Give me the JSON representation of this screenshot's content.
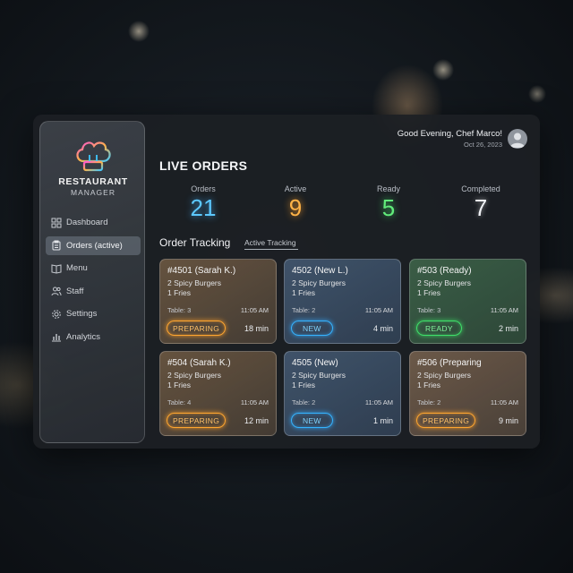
{
  "brand": {
    "name": "RESTAURANT",
    "sub": "MANAGER"
  },
  "sidebar": {
    "items": [
      {
        "label": "Dashboard",
        "icon": "grid-icon",
        "active": false
      },
      {
        "label": "Orders (active)",
        "icon": "clipboard-icon",
        "active": true
      },
      {
        "label": "Menu",
        "icon": "book-icon",
        "active": false
      },
      {
        "label": "Staff",
        "icon": "users-icon",
        "active": false
      },
      {
        "label": "Settings",
        "icon": "gear-icon",
        "active": false
      },
      {
        "label": "Analytics",
        "icon": "bar-chart-icon",
        "active": false
      }
    ]
  },
  "header": {
    "greeting": "Good Evening, Chef Marco!",
    "date": "Oct 26, 2023"
  },
  "page_title": "LIVE ORDERS",
  "stats": [
    {
      "label": "Orders",
      "value": "21",
      "color": "#5cc8ff"
    },
    {
      "label": "Active",
      "value": "9",
      "color": "#ffb347"
    },
    {
      "label": "Ready",
      "value": "5",
      "color": "#62ec7b"
    },
    {
      "label": "Completed",
      "value": "7",
      "color": "#f0f2f6"
    }
  ],
  "tracking": {
    "title": "Order Tracking",
    "tab": "Active Tracking"
  },
  "orders": [
    {
      "title": "#4501 (Sarah K.)",
      "items": [
        "2 Spicy Burgers",
        "1 Fries"
      ],
      "table": "Table: 3",
      "time": "11:05 AM",
      "status": "PREPARING",
      "elapsed": "18 min",
      "status_color": "#ffa630"
    },
    {
      "title": "4502 (New L.)",
      "items": [
        "2 Spicy Burgers",
        "1 Fries"
      ],
      "table": "Table: 2",
      "time": "11:05 AM",
      "status": "NEW",
      "elapsed": "4 min",
      "status_color": "#35b4ff"
    },
    {
      "title": "#503 (Ready)",
      "items": [
        "2 Spicy Burgers",
        "1 Fries"
      ],
      "table": "Table: 3",
      "time": "11:05 AM",
      "status": "READY",
      "elapsed": "2 min",
      "status_color": "#3fe06a"
    },
    {
      "title": "#504 (Sarah K.)",
      "items": [
        "2 Spicy Burgers",
        "1 Fries"
      ],
      "table": "Table: 4",
      "time": "11:05 AM",
      "status": "PREPARING",
      "elapsed": "12 min",
      "status_color": "#ffa630"
    },
    {
      "title": "4505 (New)",
      "items": [
        "2 Spicy Burgers",
        "1 Fries"
      ],
      "table": "Table: 2",
      "time": "11:05 AM",
      "status": "NEW",
      "elapsed": "1 min",
      "status_color": "#35b4ff"
    },
    {
      "title": "#506 (Preparing",
      "items": [
        "2 Spicy Burgers",
        "1 Fries"
      ],
      "table": "Table: 2",
      "time": "11:05 AM",
      "status": "PREPARING",
      "elapsed": "9 min",
      "status_color": "#ffa630"
    }
  ]
}
